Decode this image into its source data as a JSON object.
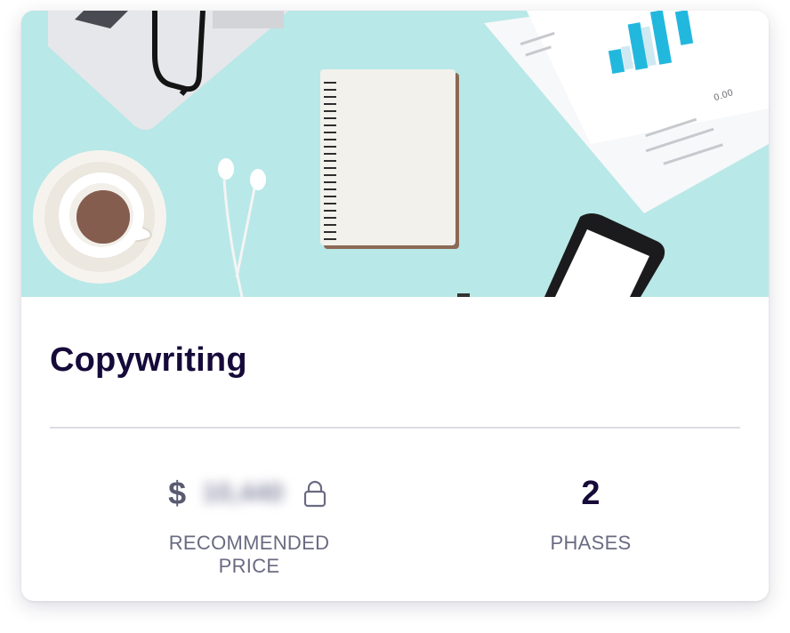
{
  "card": {
    "title": "Copywriting",
    "image_description_icon": "desk-flatlay-image"
  },
  "stats": {
    "price": {
      "currency": "$",
      "value_hidden": "10,440",
      "label": "RECOMMENDED PRICE",
      "lock_icon": "lock-icon"
    },
    "phases": {
      "value": "2",
      "label": "PHASES"
    }
  },
  "colors": {
    "title": "#160a3a",
    "label": "#6a6a82",
    "hero_bg": "#b3e6e6",
    "divider": "#dddde2"
  }
}
